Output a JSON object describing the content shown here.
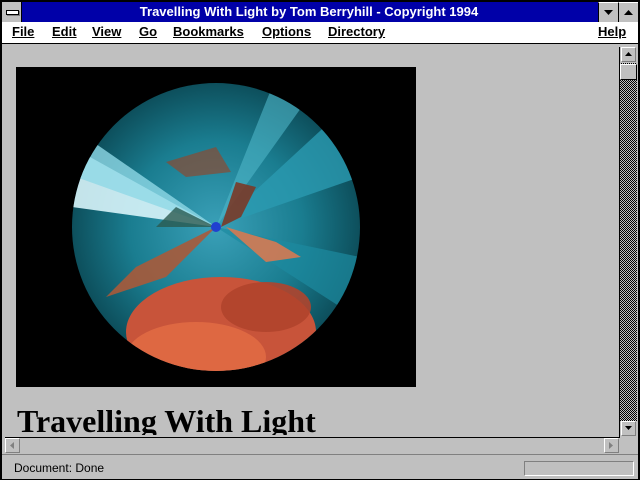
{
  "window": {
    "title": "Travelling With Light by Tom Berryhill - Copyright 1994"
  },
  "menu": {
    "file": "File",
    "edit": "Edit",
    "view": "View",
    "go": "Go",
    "bookmarks": "Bookmarks",
    "options": "Options",
    "directory": "Directory",
    "help": "Help"
  },
  "page": {
    "heading": "Travelling With Light"
  },
  "status": {
    "text": "Document: Done"
  },
  "colors": {
    "titlebar": "#0000a8",
    "chrome": "#c0c0c0",
    "menubar": "#ffffff"
  },
  "icons": [
    "system-menu-icon",
    "minimize-icon",
    "maximize-icon",
    "scroll-up-arrow-icon",
    "scroll-down-arrow-icon",
    "scroll-left-arrow-icon",
    "scroll-right-arrow-icon"
  ]
}
